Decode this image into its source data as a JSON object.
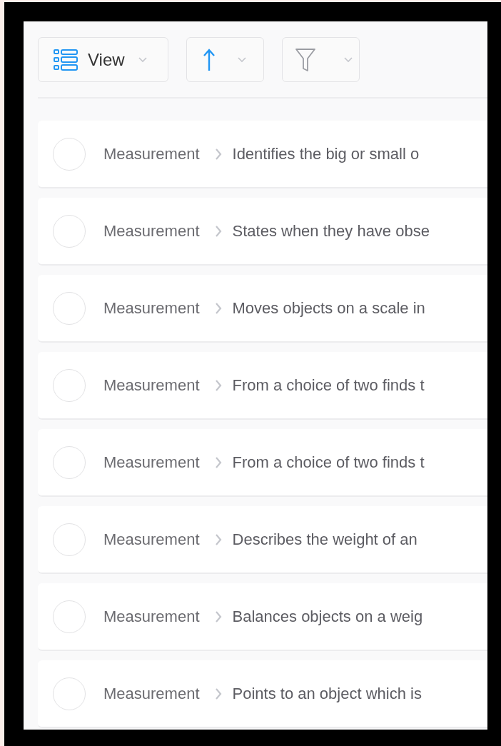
{
  "toolbar": {
    "view_button": {
      "label": "View"
    }
  },
  "rows": [
    {
      "category": "Measurement",
      "description": "Identifies the big or small o",
      "checked": false
    },
    {
      "category": "Measurement",
      "description": "States when they have obse",
      "checked": false
    },
    {
      "category": "Measurement",
      "description": "Moves objects on a scale in",
      "checked": false
    },
    {
      "category": "Measurement",
      "description": "From a choice of two finds t",
      "checked": false
    },
    {
      "category": "Measurement",
      "description": "From a choice of two finds t",
      "checked": false
    },
    {
      "category": "Measurement",
      "description": "Describes the weight of an",
      "checked": false
    },
    {
      "category": "Measurement",
      "description": "Balances objects on a weig",
      "checked": false
    },
    {
      "category": "Measurement",
      "description": "Points to an object which is",
      "checked": false
    }
  ]
}
